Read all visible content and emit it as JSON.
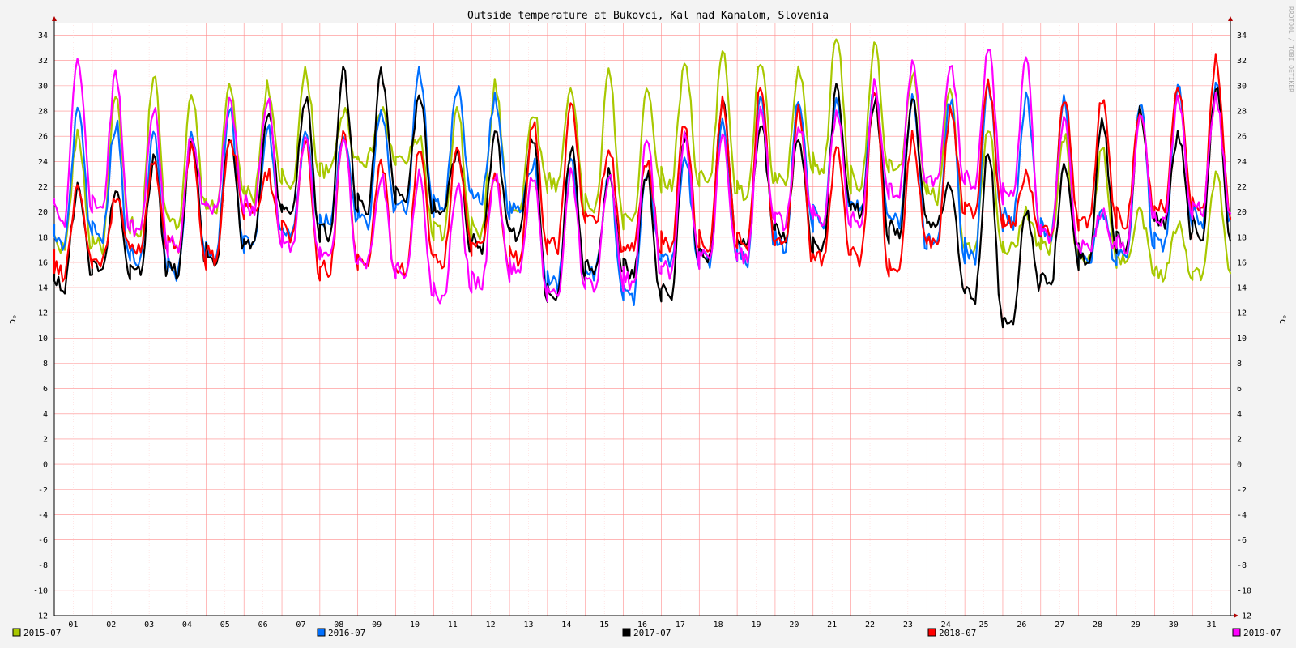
{
  "chart_data": {
    "type": "line",
    "title": "Outside temperature at Bukovci, Kal nad Kanalom, Slovenia",
    "ylabel": "°C",
    "ylabel_right": "°C",
    "watermark": "RRDTOOL / TOBI OETIKER",
    "ylim": [
      -12,
      35
    ],
    "yticks": [
      -12,
      -10,
      -8,
      -6,
      -4,
      -2,
      0,
      2,
      4,
      6,
      8,
      10,
      12,
      14,
      16,
      18,
      20,
      22,
      24,
      26,
      28,
      30,
      32,
      34
    ],
    "xlim": [
      1,
      32
    ],
    "x_tick_labels": [
      "01",
      "02",
      "03",
      "04",
      "05",
      "06",
      "07",
      "08",
      "09",
      "10",
      "11",
      "12",
      "13",
      "14",
      "15",
      "16",
      "17",
      "18",
      "19",
      "20",
      "21",
      "22",
      "23",
      "24",
      "25",
      "26",
      "27",
      "28",
      "29",
      "30",
      "31"
    ],
    "grid": true,
    "legend_position": "bottom",
    "series": [
      {
        "name": "2015-07",
        "color": "#a8c800",
        "min": [
          17,
          17,
          18,
          19,
          20,
          21,
          22,
          23,
          24,
          24,
          18,
          18,
          20,
          22,
          20,
          19,
          22,
          22,
          21,
          22,
          23,
          22,
          23,
          21,
          17,
          17,
          17,
          16,
          16,
          15,
          15
        ],
        "max": [
          26,
          29,
          31,
          29,
          30,
          30,
          31,
          28,
          28,
          26,
          28,
          30,
          28,
          30,
          31,
          30,
          32,
          33,
          32,
          31,
          34,
          33,
          31,
          30,
          27,
          20,
          26,
          25,
          20,
          19,
          23
        ]
      },
      {
        "name": "2016-07",
        "color": "#0070ff",
        "min": [
          17,
          18,
          16,
          15,
          16,
          17,
          18,
          19,
          19,
          20,
          20,
          21,
          20,
          14,
          15,
          13,
          16,
          16,
          16,
          17,
          19,
          20,
          19,
          17,
          16,
          19,
          18,
          16,
          16,
          17,
          19
        ],
        "max": [
          28,
          27,
          26,
          26,
          28,
          27,
          26,
          26,
          28,
          31,
          30,
          29,
          24,
          24,
          23,
          23,
          24,
          27,
          29,
          29,
          29,
          30,
          29,
          29,
          30,
          29,
          29,
          20,
          29,
          30,
          30
        ]
      },
      {
        "name": "2017-07",
        "color": "#000000",
        "min": [
          14,
          15,
          15,
          15,
          16,
          17,
          20,
          18,
          20,
          21,
          20,
          17,
          18,
          13,
          15,
          15,
          13,
          16,
          17,
          18,
          17,
          20,
          18,
          19,
          13,
          11,
          14,
          16,
          17,
          19,
          18
        ],
        "max": [
          22,
          22,
          24,
          26,
          26,
          28,
          29,
          31,
          31,
          29,
          25,
          26,
          26,
          25,
          23,
          23,
          26,
          29,
          27,
          26,
          30,
          29,
          29,
          22,
          25,
          20,
          24,
          27,
          28,
          26,
          30
        ]
      },
      {
        "name": "2018-07",
        "color": "#ff0000",
        "min": [
          15,
          16,
          17,
          17,
          16,
          20,
          18,
          15,
          16,
          15,
          16,
          17,
          16,
          17,
          19,
          17,
          17,
          17,
          17,
          17,
          16,
          16,
          15,
          17,
          20,
          19,
          18,
          19,
          19,
          20,
          20
        ],
        "max": [
          22,
          21,
          24,
          25,
          26,
          23,
          26,
          26,
          24,
          25,
          25,
          23,
          27,
          29,
          25,
          24,
          27,
          29,
          30,
          28,
          25,
          30,
          26,
          28,
          30,
          23,
          29,
          29,
          28,
          30,
          32
        ]
      },
      {
        "name": "2019-07",
        "color": "#ff00ff",
        "min": [
          19,
          20,
          18,
          17,
          20,
          20,
          17,
          16,
          16,
          15,
          13,
          14,
          15,
          13,
          14,
          14,
          15,
          16,
          16,
          19,
          19,
          19,
          21,
          22,
          22,
          21,
          18,
          17,
          17,
          19,
          20
        ],
        "max": [
          32,
          31,
          28,
          26,
          29,
          29,
          26,
          26,
          23,
          23,
          22,
          23,
          23,
          23,
          23,
          26,
          26,
          26,
          28,
          27,
          28,
          30,
          32,
          32,
          33,
          32,
          27,
          20,
          28,
          29,
          29
        ]
      }
    ]
  }
}
